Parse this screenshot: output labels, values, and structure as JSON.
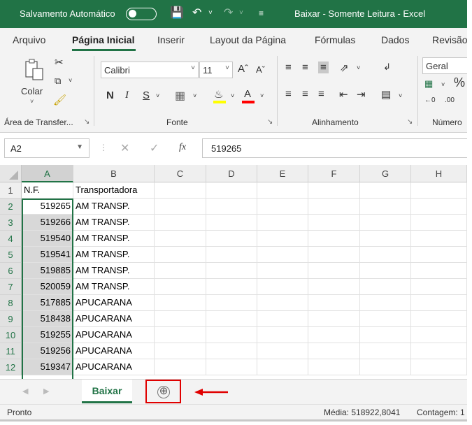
{
  "titlebar": {
    "autosave_label": "Salvamento Automático",
    "title": "Baixar - Somente Leitura - Excel"
  },
  "tabs": [
    "Arquivo",
    "Página Inicial",
    "Inserir",
    "Layout da Página",
    "Fórmulas",
    "Dados",
    "Revisão"
  ],
  "ribbon": {
    "paste_label": "Colar",
    "bold": "N",
    "italic": "I",
    "underline": "S",
    "font_name": "Calibri",
    "font_size": "11",
    "number_format": "Geral",
    "groups": {
      "clipboard": "Área de Transfer...",
      "font": "Fonte",
      "alignment": "Alinhamento",
      "number": "Número"
    },
    "colors": {
      "highlight": "#ffff00",
      "font_color": "#ff0000",
      "accent": "#217346"
    }
  },
  "formula_bar": {
    "name_box": "A2",
    "fx": "fx",
    "value": "519265"
  },
  "grid": {
    "columns": [
      "A",
      "B",
      "C",
      "D",
      "E",
      "F",
      "G",
      "H"
    ],
    "rows": [
      {
        "n": "1",
        "a": "N.F.",
        "b": "Transportadora"
      },
      {
        "n": "2",
        "a": "519265",
        "b": "AM TRANSP."
      },
      {
        "n": "3",
        "a": "519266",
        "b": "AM TRANSP."
      },
      {
        "n": "4",
        "a": "519540",
        "b": "AM TRANSP."
      },
      {
        "n": "5",
        "a": "519541",
        "b": "AM TRANSP."
      },
      {
        "n": "6",
        "a": "519885",
        "b": "AM TRANSP."
      },
      {
        "n": "7",
        "a": "520059",
        "b": "AM TRANSP."
      },
      {
        "n": "8",
        "a": "517885",
        "b": "APUCARANA"
      },
      {
        "n": "9",
        "a": "518438",
        "b": "APUCARANA"
      },
      {
        "n": "10",
        "a": "519255",
        "b": "APUCARANA"
      },
      {
        "n": "11",
        "a": "519256",
        "b": "APUCARANA"
      },
      {
        "n": "12",
        "a": "519347",
        "b": "APUCARANA"
      }
    ]
  },
  "sheets": {
    "active": "Baixar",
    "add_icon": "⊕"
  },
  "statusbar": {
    "ready": "Pronto",
    "average": "Média: 518922,8041",
    "count": "Contagem: 1"
  }
}
